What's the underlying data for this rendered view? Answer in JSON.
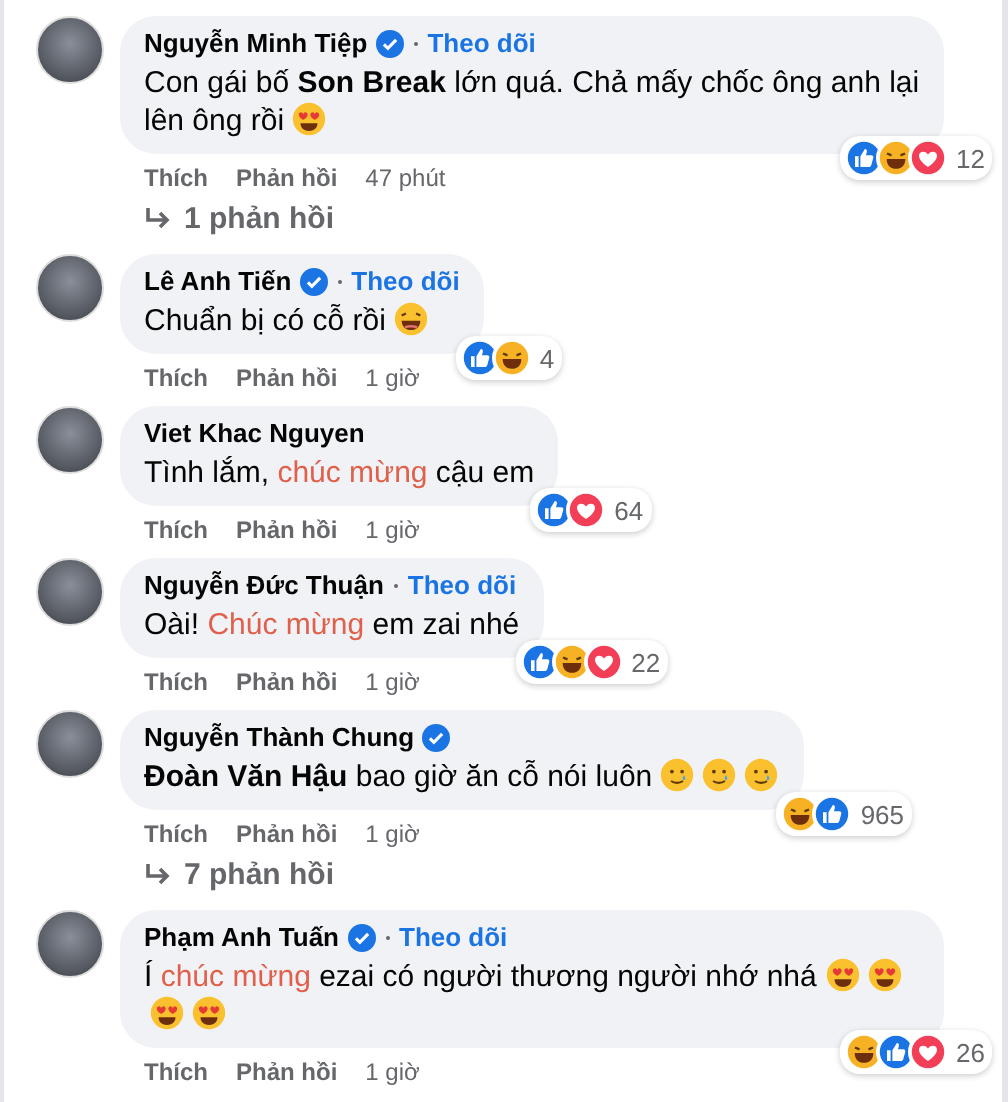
{
  "comments": [
    {
      "name": "Nguyễn Minh Tiệp",
      "verified": true,
      "follow": "Theo dõi",
      "body": [
        {
          "kind": "text",
          "text": "Con gái bố "
        },
        {
          "kind": "bold",
          "text": "Son Break"
        },
        {
          "kind": "text",
          "text": " lớn quá. Chả mấy chốc ông anh lại lên ông rồi "
        },
        {
          "kind": "heart-eyes"
        }
      ],
      "reactions": [
        {
          "kind": "like"
        },
        {
          "kind": "haha"
        },
        {
          "kind": "love"
        }
      ],
      "reaction_count": "12",
      "actions": [
        "Thích",
        "Phản hồi"
      ],
      "time": "47 phút",
      "replies": "1 phản hồi"
    },
    {
      "name": "Lê Anh Tiến",
      "verified": true,
      "follow": "Theo dõi",
      "body": [
        {
          "kind": "text",
          "text": "Chuẩn bị có cỗ rồi "
        },
        {
          "kind": "laughing"
        }
      ],
      "reactions": [
        {
          "kind": "like"
        },
        {
          "kind": "haha"
        }
      ],
      "reaction_count": "4",
      "actions": [
        "Thích",
        "Phản hồi"
      ],
      "time": "1 giờ"
    },
    {
      "name": "Viet Khac Nguyen",
      "body": [
        {
          "kind": "text",
          "text": "Tình lắm, "
        },
        {
          "kind": "highlight",
          "text": "chúc mừng"
        },
        {
          "kind": "text",
          "text": " cậu em"
        }
      ],
      "reactions": [
        {
          "kind": "like"
        },
        {
          "kind": "love"
        }
      ],
      "reaction_count": "64",
      "actions": [
        "Thích",
        "Phản hồi"
      ],
      "time": "1 giờ"
    },
    {
      "name": "Nguyễn Đức Thuận",
      "follow": "Theo dõi",
      "body": [
        {
          "kind": "text",
          "text": "Oài! "
        },
        {
          "kind": "highlight",
          "text": "Chúc mừng"
        },
        {
          "kind": "text",
          "text": " em zai nhé"
        }
      ],
      "reactions": [
        {
          "kind": "like"
        },
        {
          "kind": "haha"
        },
        {
          "kind": "love"
        }
      ],
      "reaction_count": "22",
      "actions": [
        "Thích",
        "Phản hồi"
      ],
      "time": "1 giờ"
    },
    {
      "name": "Nguyễn Thành Chung",
      "verified": true,
      "body": [
        {
          "kind": "bold",
          "text": "Đoàn Văn Hậu"
        },
        {
          "kind": "text",
          "text": " bao giờ ăn cỗ nói luôn "
        },
        {
          "kind": "teary"
        },
        {
          "kind": "teary"
        },
        {
          "kind": "teary"
        }
      ],
      "reactions": [
        {
          "kind": "haha"
        },
        {
          "kind": "like"
        }
      ],
      "reaction_count": "965",
      "actions": [
        "Thích",
        "Phản hồi"
      ],
      "time": "1 giờ",
      "replies": "7 phản hồi"
    },
    {
      "name": "Phạm Anh Tuấn",
      "verified": true,
      "follow": "Theo dõi",
      "body": [
        {
          "kind": "text",
          "text": "Í "
        },
        {
          "kind": "highlight",
          "text": "chúc mừng"
        },
        {
          "kind": "text",
          "text": " ezai có người thương người nhớ nhá "
        },
        {
          "kind": "heart-eyes"
        },
        {
          "kind": "heart-eyes"
        },
        {
          "kind": "heart-eyes"
        },
        {
          "kind": "heart-eyes"
        }
      ],
      "reactions": [
        {
          "kind": "haha"
        },
        {
          "kind": "like"
        },
        {
          "kind": "love"
        }
      ],
      "reaction_count": "26",
      "actions": [
        "Thích",
        "Phản hồi"
      ],
      "time": "1 giờ"
    }
  ]
}
